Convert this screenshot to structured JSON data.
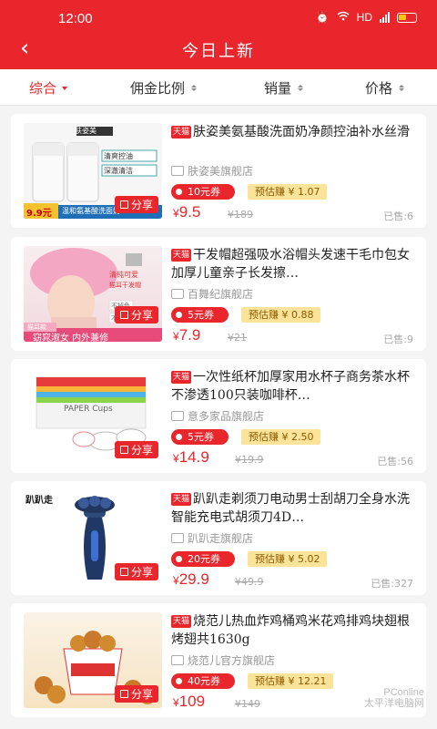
{
  "status": {
    "time": "12:00",
    "network": "HD"
  },
  "nav": {
    "back": "‹",
    "title": "今日上新"
  },
  "filters": [
    {
      "label": "综合",
      "active": true
    },
    {
      "label": "佣金比例"
    },
    {
      "label": "销量"
    },
    {
      "label": "价格"
    }
  ],
  "products": [
    {
      "tmall": "天猫",
      "title": "肤姿美氨基酸洗面奶净颜控油补水丝滑",
      "shop": "肤姿美旗舰店",
      "coupon": "10元券",
      "earn": "预估赚 ¥ 1.07",
      "price_symbol": "¥",
      "price": "9.5",
      "orig": "¥189",
      "sold": "已售:6",
      "share": "分享",
      "img": {
        "brand": "肤姿美",
        "line1": "清爽控油",
        "line2": "深澈清洁",
        "badge_price": "9.9元",
        "badge_text": "温和氨基酸洗面奶"
      }
    },
    {
      "tmall": "天猫",
      "title": "干发帽超强吸水浴帽头发速干毛巾包女加厚儿童亲子长发擦…",
      "shop": "百舞纪旗舰店",
      "coupon": "5元券",
      "earn": "预估赚 ¥ 0.88",
      "price_symbol": "¥",
      "price": "7.9",
      "orig": "¥21",
      "sold": "已售:9",
      "share": "分享",
      "img": {
        "line1": "清纯可爱",
        "line2": "猫耳干发帽",
        "tag1": "不掉色",
        "tag2": "不掉毛",
        "badge1": "猫耳款",
        "badge2": "窈窕淑女 内外兼修"
      }
    },
    {
      "tmall": "天猫",
      "title": "一次性纸杯加厚家用水杯子商务茶水杯不渗透100只装咖啡杯…",
      "shop": "意多家品旗舰店",
      "coupon": "5元券",
      "earn": "预估赚 ¥ 2.50",
      "price_symbol": "¥",
      "price": "14.9",
      "orig": "¥19.9",
      "sold": "已售:56",
      "share": "分享",
      "img": {
        "label": "PAPER Cups"
      }
    },
    {
      "tmall": "天猫",
      "title": "趴趴走剃须刀电动男士刮胡刀全身水洗智能充电式胡须刀4D…",
      "shop": "趴趴走旗舰店",
      "coupon": "20元券",
      "earn": "预估赚 ¥ 5.02",
      "price_symbol": "¥",
      "price": "29.9",
      "orig": "¥49.9",
      "sold": "已售:327",
      "share": "分享",
      "img": {
        "brand": "趴趴走"
      }
    },
    {
      "tmall": "天猫",
      "title": "烧范儿热血炸鸡桶鸡米花鸡排鸡块翅根烤翅共1630g",
      "shop": "烧范儿官方旗舰店",
      "coupon": "40元券",
      "earn": "预估赚 ¥ 12.21",
      "price_symbol": "¥",
      "price": "109",
      "orig": "¥149",
      "sold": "",
      "share": "分享",
      "img": {}
    }
  ],
  "watermark": {
    "line1": "PConline",
    "line2": "太平洋电脑网"
  },
  "colors": {
    "accent": "#e8262c",
    "earn_bg": "#fbe39a"
  }
}
